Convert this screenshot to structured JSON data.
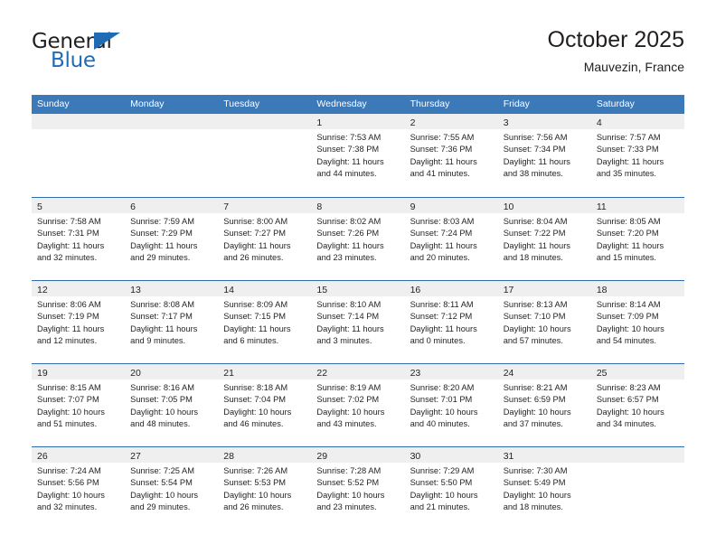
{
  "logo": {
    "text_primary": "General",
    "text_secondary": "Blue",
    "triangle_icon": "triangle-icon",
    "color_primary": "#231f20",
    "color_secondary": "#1f6cb4"
  },
  "header": {
    "title": "October 2025",
    "subtitle": "Mauvezin, France"
  },
  "colors": {
    "header_row_bg": "#3b79b8",
    "header_row_text": "#ffffff",
    "row_divider": "#2f6bab",
    "day_band_bg": "#efefef",
    "cell_bg": "#ffffff",
    "text": "#231f20"
  },
  "weekdays": [
    "Sunday",
    "Monday",
    "Tuesday",
    "Wednesday",
    "Thursday",
    "Friday",
    "Saturday"
  ],
  "weeks": [
    [
      {
        "day": "",
        "lines": []
      },
      {
        "day": "",
        "lines": []
      },
      {
        "day": "",
        "lines": []
      },
      {
        "day": "1",
        "lines": [
          "Sunrise: 7:53 AM",
          "Sunset: 7:38 PM",
          "Daylight: 11 hours",
          "and 44 minutes."
        ]
      },
      {
        "day": "2",
        "lines": [
          "Sunrise: 7:55 AM",
          "Sunset: 7:36 PM",
          "Daylight: 11 hours",
          "and 41 minutes."
        ]
      },
      {
        "day": "3",
        "lines": [
          "Sunrise: 7:56 AM",
          "Sunset: 7:34 PM",
          "Daylight: 11 hours",
          "and 38 minutes."
        ]
      },
      {
        "day": "4",
        "lines": [
          "Sunrise: 7:57 AM",
          "Sunset: 7:33 PM",
          "Daylight: 11 hours",
          "and 35 minutes."
        ]
      }
    ],
    [
      {
        "day": "5",
        "lines": [
          "Sunrise: 7:58 AM",
          "Sunset: 7:31 PM",
          "Daylight: 11 hours",
          "and 32 minutes."
        ]
      },
      {
        "day": "6",
        "lines": [
          "Sunrise: 7:59 AM",
          "Sunset: 7:29 PM",
          "Daylight: 11 hours",
          "and 29 minutes."
        ]
      },
      {
        "day": "7",
        "lines": [
          "Sunrise: 8:00 AM",
          "Sunset: 7:27 PM",
          "Daylight: 11 hours",
          "and 26 minutes."
        ]
      },
      {
        "day": "8",
        "lines": [
          "Sunrise: 8:02 AM",
          "Sunset: 7:26 PM",
          "Daylight: 11 hours",
          "and 23 minutes."
        ]
      },
      {
        "day": "9",
        "lines": [
          "Sunrise: 8:03 AM",
          "Sunset: 7:24 PM",
          "Daylight: 11 hours",
          "and 20 minutes."
        ]
      },
      {
        "day": "10",
        "lines": [
          "Sunrise: 8:04 AM",
          "Sunset: 7:22 PM",
          "Daylight: 11 hours",
          "and 18 minutes."
        ]
      },
      {
        "day": "11",
        "lines": [
          "Sunrise: 8:05 AM",
          "Sunset: 7:20 PM",
          "Daylight: 11 hours",
          "and 15 minutes."
        ]
      }
    ],
    [
      {
        "day": "12",
        "lines": [
          "Sunrise: 8:06 AM",
          "Sunset: 7:19 PM",
          "Daylight: 11 hours",
          "and 12 minutes."
        ]
      },
      {
        "day": "13",
        "lines": [
          "Sunrise: 8:08 AM",
          "Sunset: 7:17 PM",
          "Daylight: 11 hours",
          "and 9 minutes."
        ]
      },
      {
        "day": "14",
        "lines": [
          "Sunrise: 8:09 AM",
          "Sunset: 7:15 PM",
          "Daylight: 11 hours",
          "and 6 minutes."
        ]
      },
      {
        "day": "15",
        "lines": [
          "Sunrise: 8:10 AM",
          "Sunset: 7:14 PM",
          "Daylight: 11 hours",
          "and 3 minutes."
        ]
      },
      {
        "day": "16",
        "lines": [
          "Sunrise: 8:11 AM",
          "Sunset: 7:12 PM",
          "Daylight: 11 hours",
          "and 0 minutes."
        ]
      },
      {
        "day": "17",
        "lines": [
          "Sunrise: 8:13 AM",
          "Sunset: 7:10 PM",
          "Daylight: 10 hours",
          "and 57 minutes."
        ]
      },
      {
        "day": "18",
        "lines": [
          "Sunrise: 8:14 AM",
          "Sunset: 7:09 PM",
          "Daylight: 10 hours",
          "and 54 minutes."
        ]
      }
    ],
    [
      {
        "day": "19",
        "lines": [
          "Sunrise: 8:15 AM",
          "Sunset: 7:07 PM",
          "Daylight: 10 hours",
          "and 51 minutes."
        ]
      },
      {
        "day": "20",
        "lines": [
          "Sunrise: 8:16 AM",
          "Sunset: 7:05 PM",
          "Daylight: 10 hours",
          "and 48 minutes."
        ]
      },
      {
        "day": "21",
        "lines": [
          "Sunrise: 8:18 AM",
          "Sunset: 7:04 PM",
          "Daylight: 10 hours",
          "and 46 minutes."
        ]
      },
      {
        "day": "22",
        "lines": [
          "Sunrise: 8:19 AM",
          "Sunset: 7:02 PM",
          "Daylight: 10 hours",
          "and 43 minutes."
        ]
      },
      {
        "day": "23",
        "lines": [
          "Sunrise: 8:20 AM",
          "Sunset: 7:01 PM",
          "Daylight: 10 hours",
          "and 40 minutes."
        ]
      },
      {
        "day": "24",
        "lines": [
          "Sunrise: 8:21 AM",
          "Sunset: 6:59 PM",
          "Daylight: 10 hours",
          "and 37 minutes."
        ]
      },
      {
        "day": "25",
        "lines": [
          "Sunrise: 8:23 AM",
          "Sunset: 6:57 PM",
          "Daylight: 10 hours",
          "and 34 minutes."
        ]
      }
    ],
    [
      {
        "day": "26",
        "lines": [
          "Sunrise: 7:24 AM",
          "Sunset: 5:56 PM",
          "Daylight: 10 hours",
          "and 32 minutes."
        ]
      },
      {
        "day": "27",
        "lines": [
          "Sunrise: 7:25 AM",
          "Sunset: 5:54 PM",
          "Daylight: 10 hours",
          "and 29 minutes."
        ]
      },
      {
        "day": "28",
        "lines": [
          "Sunrise: 7:26 AM",
          "Sunset: 5:53 PM",
          "Daylight: 10 hours",
          "and 26 minutes."
        ]
      },
      {
        "day": "29",
        "lines": [
          "Sunrise: 7:28 AM",
          "Sunset: 5:52 PM",
          "Daylight: 10 hours",
          "and 23 minutes."
        ]
      },
      {
        "day": "30",
        "lines": [
          "Sunrise: 7:29 AM",
          "Sunset: 5:50 PM",
          "Daylight: 10 hours",
          "and 21 minutes."
        ]
      },
      {
        "day": "31",
        "lines": [
          "Sunrise: 7:30 AM",
          "Sunset: 5:49 PM",
          "Daylight: 10 hours",
          "and 18 minutes."
        ]
      },
      {
        "day": "",
        "lines": []
      }
    ]
  ]
}
